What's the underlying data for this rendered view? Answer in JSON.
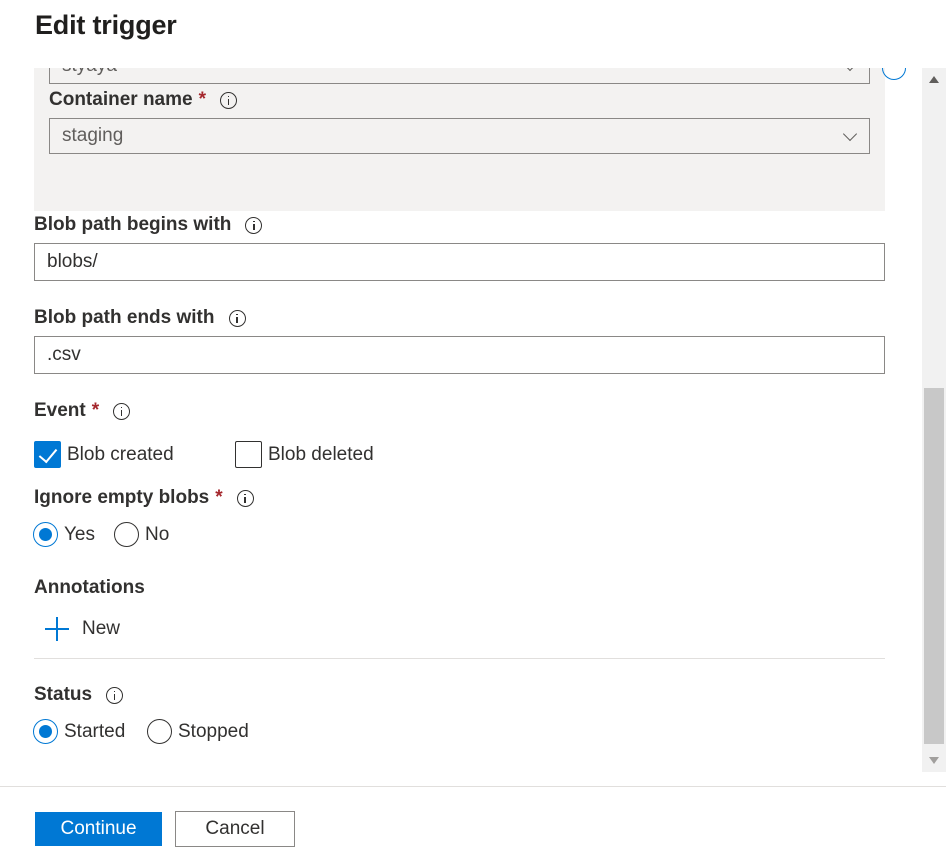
{
  "header": {
    "title": "Edit trigger"
  },
  "storage_account": {
    "value": "styaya"
  },
  "container": {
    "label": "Container name",
    "required_mark": "*",
    "value": "staging"
  },
  "blob_begins": {
    "label": "Blob path begins with",
    "value": "blobs/"
  },
  "blob_ends": {
    "label": "Blob path ends with",
    "value": ".csv"
  },
  "event": {
    "label": "Event",
    "required_mark": "*",
    "options": [
      {
        "label": "Blob created",
        "checked": true
      },
      {
        "label": "Blob deleted",
        "checked": false
      }
    ]
  },
  "ignore_empty": {
    "label": "Ignore empty blobs",
    "required_mark": "*",
    "options": [
      {
        "label": "Yes",
        "selected": true
      },
      {
        "label": "No",
        "selected": false
      }
    ]
  },
  "annotations": {
    "label": "Annotations",
    "new_label": "New"
  },
  "status": {
    "label": "Status",
    "options": [
      {
        "label": "Started",
        "selected": true
      },
      {
        "label": "Stopped",
        "selected": false
      }
    ]
  },
  "footer": {
    "continue_label": "Continue",
    "cancel_label": "Cancel"
  },
  "colors": {
    "accent": "#0078d4",
    "required": "#a4262c",
    "panel_bg": "#f3f2f1"
  }
}
